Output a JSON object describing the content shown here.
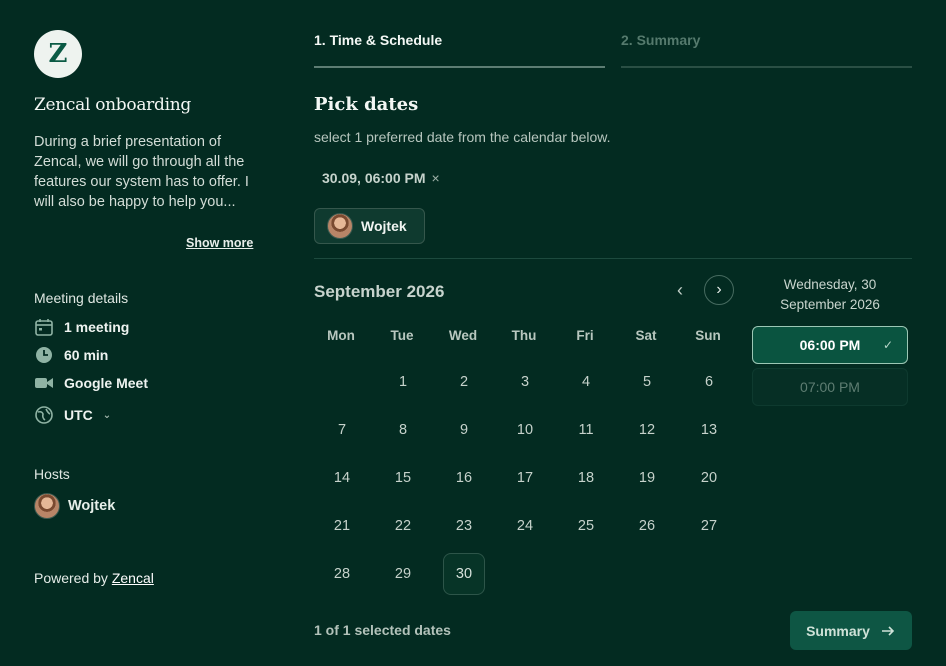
{
  "brand": {
    "logo_letter": "Z",
    "title": "Zencal onboarding"
  },
  "description": "During a brief presentation of Zencal, we will go through all the features our system has to offer. I will also be happy to help you...",
  "show_more": "Show more",
  "meeting_details": {
    "heading": "Meeting details",
    "count": "1 meeting",
    "duration": "60 min",
    "location": "Google Meet",
    "timezone": "UTC"
  },
  "hosts": {
    "heading": "Hosts",
    "name": "Wojtek"
  },
  "powered": {
    "prefix": "Powered by ",
    "link": "Zencal"
  },
  "steps": [
    {
      "label": "1. Time & Schedule",
      "active": true
    },
    {
      "label": "2. Summary",
      "active": false
    }
  ],
  "pick": {
    "title": "Pick dates",
    "subtitle": "select 1 preferred date from the calendar below.",
    "selected_chip": "30.09, 06:00 PM",
    "remove_symbol": "×",
    "host_chip": "Wojtek"
  },
  "calendar": {
    "month": "September 2026",
    "weekdays": [
      "Mon",
      "Tue",
      "Wed",
      "Thu",
      "Fri",
      "Sat",
      "Sun"
    ],
    "first_weekday_index": 1,
    "days_in_month": 30,
    "selected_day": 30
  },
  "times": {
    "date_line1": "Wednesday, 30",
    "date_line2": "September 2026",
    "slots": [
      {
        "label": "06:00 PM",
        "state": "active"
      },
      {
        "label": "07:00 PM",
        "state": "disabled"
      }
    ]
  },
  "footer": {
    "count": "1 of 1 selected dates",
    "button": "Summary"
  },
  "colors": {
    "background": "#032b21",
    "accent": "#0a5440",
    "accent_border": "#9cc7b5"
  }
}
